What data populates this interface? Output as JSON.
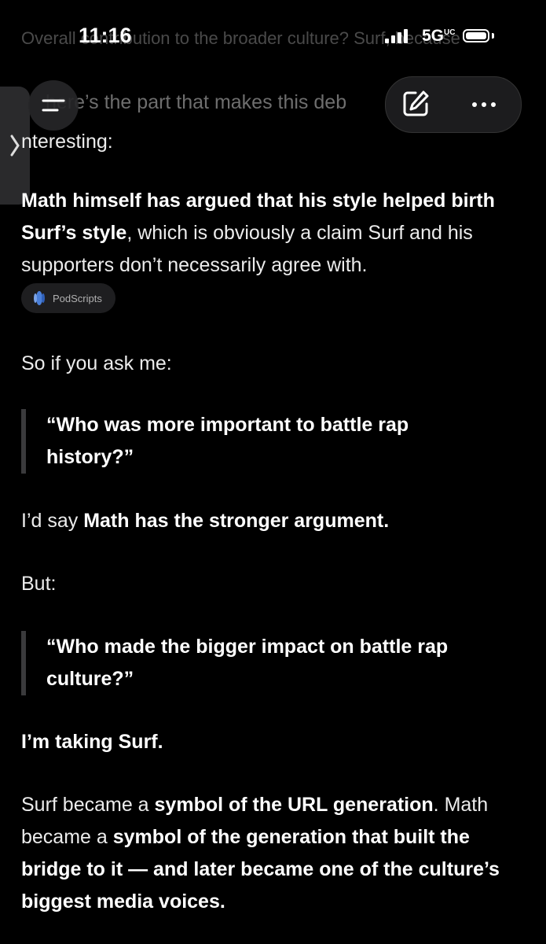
{
  "status_bar": {
    "background_text": "Overall contribution to the broader culture? Surf, because",
    "time": "11:16",
    "network": "5G",
    "network_suffix": "UC"
  },
  "toolbar": {
    "dimmed_text": "here’s the part that makes this deb",
    "side_tab_icon": "chevron-right-icon",
    "menu_icon": "hamburger-icon",
    "edit_icon": "compose-icon",
    "more_icon": "ellipsis-icon"
  },
  "content": {
    "p0_cont": "nteresting:",
    "p1_bold": "Math himself has argued that his style helped birth Surf’s style",
    "p1_rest": ", which is obviously a claim Surf and his supporters don’t necessarily agree with.",
    "source_chip": "PodScripts",
    "p2": "So if you ask me:",
    "quote1": "“Who was more important to battle rap history?”",
    "p3_pre": "I’d say ",
    "p3_bold": "Math has the stronger argument.",
    "p4": "But:",
    "quote2": "“Who made the bigger impact on battle rap culture?”",
    "p5": "I’m taking Surf.",
    "p6_a": "Surf became a ",
    "p6_b": "symbol of the URL generation",
    "p6_c": ". Math became a ",
    "p6_d": "symbol of the generation that built the bridge to it — and later became one of the culture’s biggest media voices."
  },
  "colors": {
    "background": "#000000",
    "text": "#ececec",
    "dim": "#6e6e6e",
    "chip": "#1e1e20"
  }
}
